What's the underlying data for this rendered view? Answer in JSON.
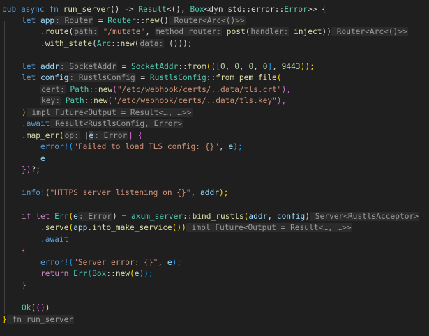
{
  "editor": {
    "colors": {
      "background": "#1f1f1f",
      "keyword": "#569cd6",
      "function": "#dcdcaa",
      "type": "#4ec9b0",
      "variable": "#9cdcfe",
      "string": "#ce9178",
      "number": "#b5cea8",
      "inlay_hint_bg": "#2b2b2b"
    },
    "code": {
      "l1": {
        "a": "pub async fn ",
        "b": "run_server",
        "c": "() -> ",
        "d": "Result",
        "e": "<(), ",
        "f": "Box",
        "g": "<dyn std::error::",
        "h": "Error",
        "i": ">> {"
      },
      "l2": {
        "a": "let ",
        "b": "app",
        "h1": ": Router",
        "c": " = ",
        "d": "Router",
        "e": "::",
        "f": "new",
        "g": "()",
        "h2": " Router<Arc<()>>"
      },
      "l3": {
        "a": ".",
        "b": "route",
        "c": "(",
        "h1": "path:",
        "d": " \"/mutate\"",
        "e": ", ",
        "h2": "method_router:",
        "f": " post",
        "g": "(",
        "h3": "handler:",
        "i": " inject",
        "j": "))",
        "h4": " Router<Arc<()>>"
      },
      "l4": {
        "a": ".",
        "b": "with_state",
        "c": "(",
        "d": "Arc",
        "e": "::",
        "f": "new",
        "g": "(",
        "h1": "data:",
        "i": " ()",
        "j": "));"
      },
      "l5": {
        "a": "let ",
        "b": "addr",
        "h1": ": SocketAddr",
        "c": " = ",
        "d": "SocketAddr",
        "e": "::",
        "f": "from",
        "g": "((",
        "h": "[",
        "n1": "0",
        "n2": "0",
        "n3": "0",
        "n4": "0",
        "i": "]",
        "n5": "9443",
        "j": "));"
      },
      "l6": {
        "a": "let ",
        "b": "config",
        "h1": ": RustlsConfig",
        "c": " = ",
        "d": "RustlsConfig",
        "e": "::",
        "f": "from_pem_file",
        "g": "("
      },
      "l7": {
        "h1": "cert:",
        "a": " Path",
        "b": "::",
        "c": "new",
        "d": "(",
        "e": "\"/etc/webhook/certs/..data/tls.crt\"",
        "f": "),"
      },
      "l8": {
        "h1": "key:",
        "a": " Path",
        "b": "::",
        "c": "new",
        "d": "(",
        "e": "\"/etc/webhook/certs/..data/tls.key\"",
        "f": "),"
      },
      "l9": {
        "a": ")",
        "h1": " impl Future<Output = Result<…, …>>"
      },
      "l10": {
        "a": ".await",
        "h1": " Result<RustlsConfig, Error>"
      },
      "l11": {
        "a": ".",
        "b": "map_err",
        "c": "(",
        "h1": "op:",
        "d": " |",
        "e": "e",
        "h2": ": Error",
        "f": "| {"
      },
      "l12": {
        "a": "error!",
        "b": "(",
        "c": "\"Failed to load TLS config: {}\"",
        "d": ", ",
        "e": "e",
        "f": ");"
      },
      "l13": {
        "a": "e"
      },
      "l14": {
        "a": "})",
        "b": "?;"
      },
      "l15": {
        "a": "info!",
        "b": "(",
        "c": "\"HTTPS server listening on {}\"",
        "d": ", ",
        "e": "addr",
        "f": ");"
      },
      "l16": {
        "a": "if let ",
        "b": "Err",
        "c": "(",
        "d": "e",
        "h1": ": Error",
        "e": ") = ",
        "f": "axum_server",
        "g": "::",
        "h": "bind_rustls",
        "i": "(",
        "j": "addr",
        "k": ", ",
        "l": "config",
        "m": ")",
        "h2": " Server<RustlsAcceptor>"
      },
      "l17": {
        "a": ".",
        "b": "serve",
        "c": "(",
        "d": "app",
        "e": ".",
        "f": "into_make_service",
        "g": "())",
        "h1": " impl Future<Output = Result<…, …>>"
      },
      "l18": {
        "a": ".await"
      },
      "l19": {
        "a": "{"
      },
      "l20": {
        "a": "error!",
        "b": "(",
        "c": "\"Server error: {}\"",
        "d": ", ",
        "e": "e",
        "f": ");"
      },
      "l21": {
        "a": "return ",
        "b": "Err",
        "c": "(",
        "d": "Box",
        "e": "::",
        "f": "new",
        "g": "(",
        "h": "e",
        "i": "));"
      },
      "l22": {
        "a": "}"
      },
      "l23": {
        "a": "Ok",
        "b": "(",
        "c": "()",
        "d": ")"
      },
      "l24": {
        "a": "}",
        "h1": " fn run_server"
      }
    }
  }
}
